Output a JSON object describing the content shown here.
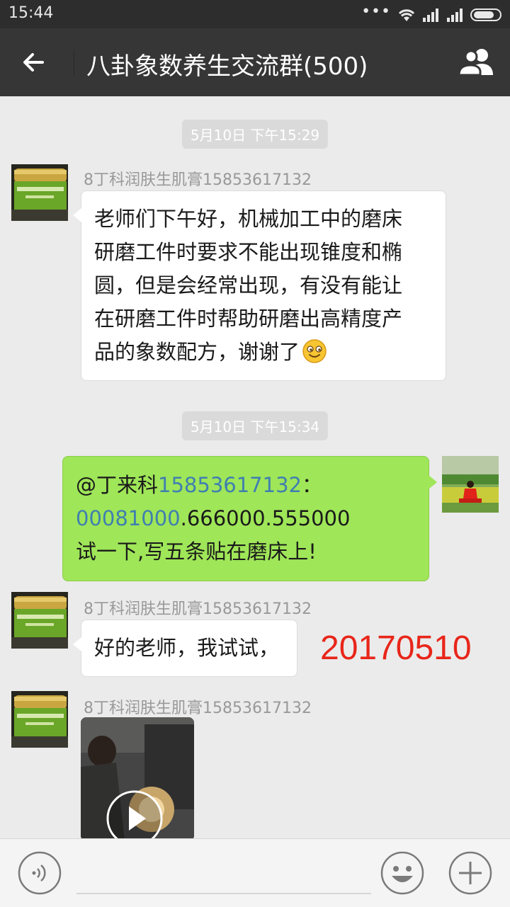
{
  "status_bar": {
    "time": "15:44"
  },
  "header": {
    "title": "八卦象数养生交流群(500)"
  },
  "messages": [
    {
      "type": "timestamp",
      "text": "5月10日 下午15:29"
    },
    {
      "type": "incoming",
      "sender": "8丁科润肤生肌膏15853617132",
      "lines": [
        "老师们下午好，机械加工中的磨床",
        "研磨工件时要求不能出现锥度和椭",
        "圆，但是会经常出现，有没有能让",
        "在研磨工件时帮助研磨出高精度产",
        "品的象数配方，谢谢了"
      ],
      "emoji": "smile"
    },
    {
      "type": "timestamp",
      "text": "5月10日 下午15:34"
    },
    {
      "type": "outgoing",
      "mention": "@丁来科",
      "phone": "15853617132",
      "colon": "：",
      "code_prefix": "00081000",
      "code_rest": ".666000.555000",
      "line3": "试一下,写五条贴在磨床上!"
    },
    {
      "type": "incoming",
      "sender": "8丁科润肤生肌膏15853617132",
      "text": "好的老师，我试试，"
    },
    {
      "type": "incoming-video",
      "sender": "8丁科润肤生肌膏15853617132"
    }
  ],
  "overlay_note": "20170510",
  "colors": {
    "outgoing_bubble": "#9fe658",
    "link": "#3f7fb0",
    "note": "#e8261a"
  }
}
